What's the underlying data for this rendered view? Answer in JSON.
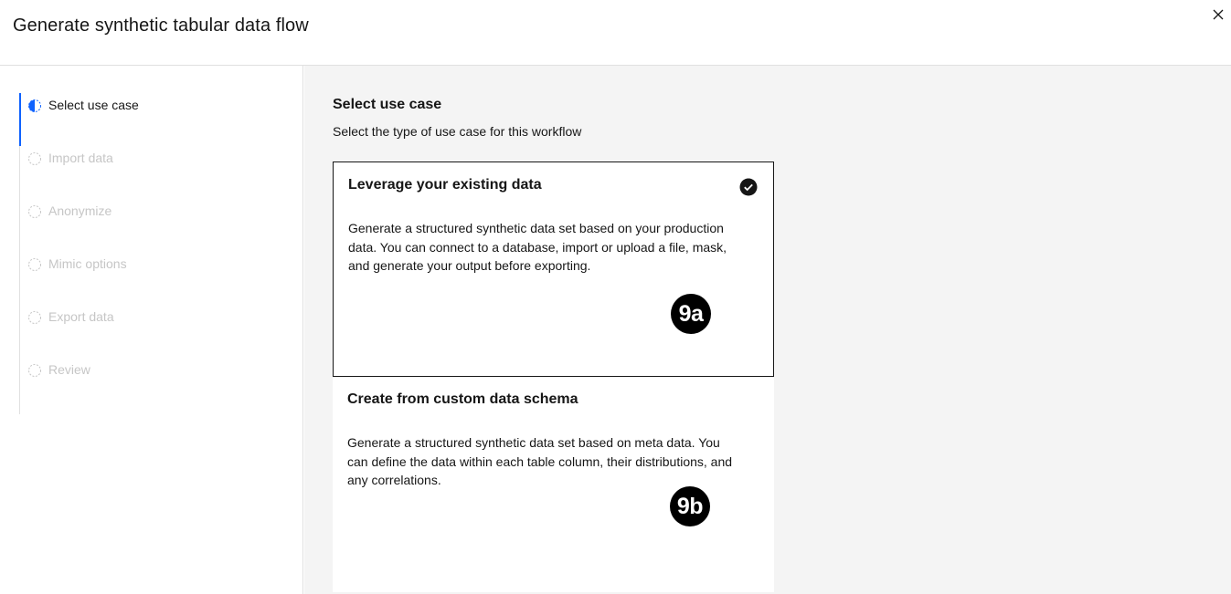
{
  "header": {
    "title": "Generate synthetic tabular data flow",
    "close_icon": "close-icon"
  },
  "steps": [
    {
      "label": "Select use case",
      "state": "current"
    },
    {
      "label": "Import data",
      "state": "incomplete"
    },
    {
      "label": "Anonymize",
      "state": "incomplete"
    },
    {
      "label": "Mimic options",
      "state": "incomplete"
    },
    {
      "label": "Export data",
      "state": "incomplete"
    },
    {
      "label": "Review",
      "state": "incomplete"
    }
  ],
  "main": {
    "title": "Select use case",
    "subtitle": "Select the type of use case for this workflow",
    "tiles": [
      {
        "title": "Leverage your existing data",
        "description": "Generate a structured synthetic data set based on your production data. You can connect to a database, import or upload a file, mask, and generate your output before exporting.",
        "selected": true,
        "badge": "9a"
      },
      {
        "title": "Create from custom data schema",
        "description": "Generate a structured synthetic data set based on meta data. You can define the data within each table column, their distributions, and any correlations.",
        "selected": false,
        "badge": "9b"
      }
    ]
  },
  "colors": {
    "accent": "#0f62fe",
    "text": "#161616",
    "disabled": "#c6c6c6",
    "background": "#f4f4f4"
  }
}
